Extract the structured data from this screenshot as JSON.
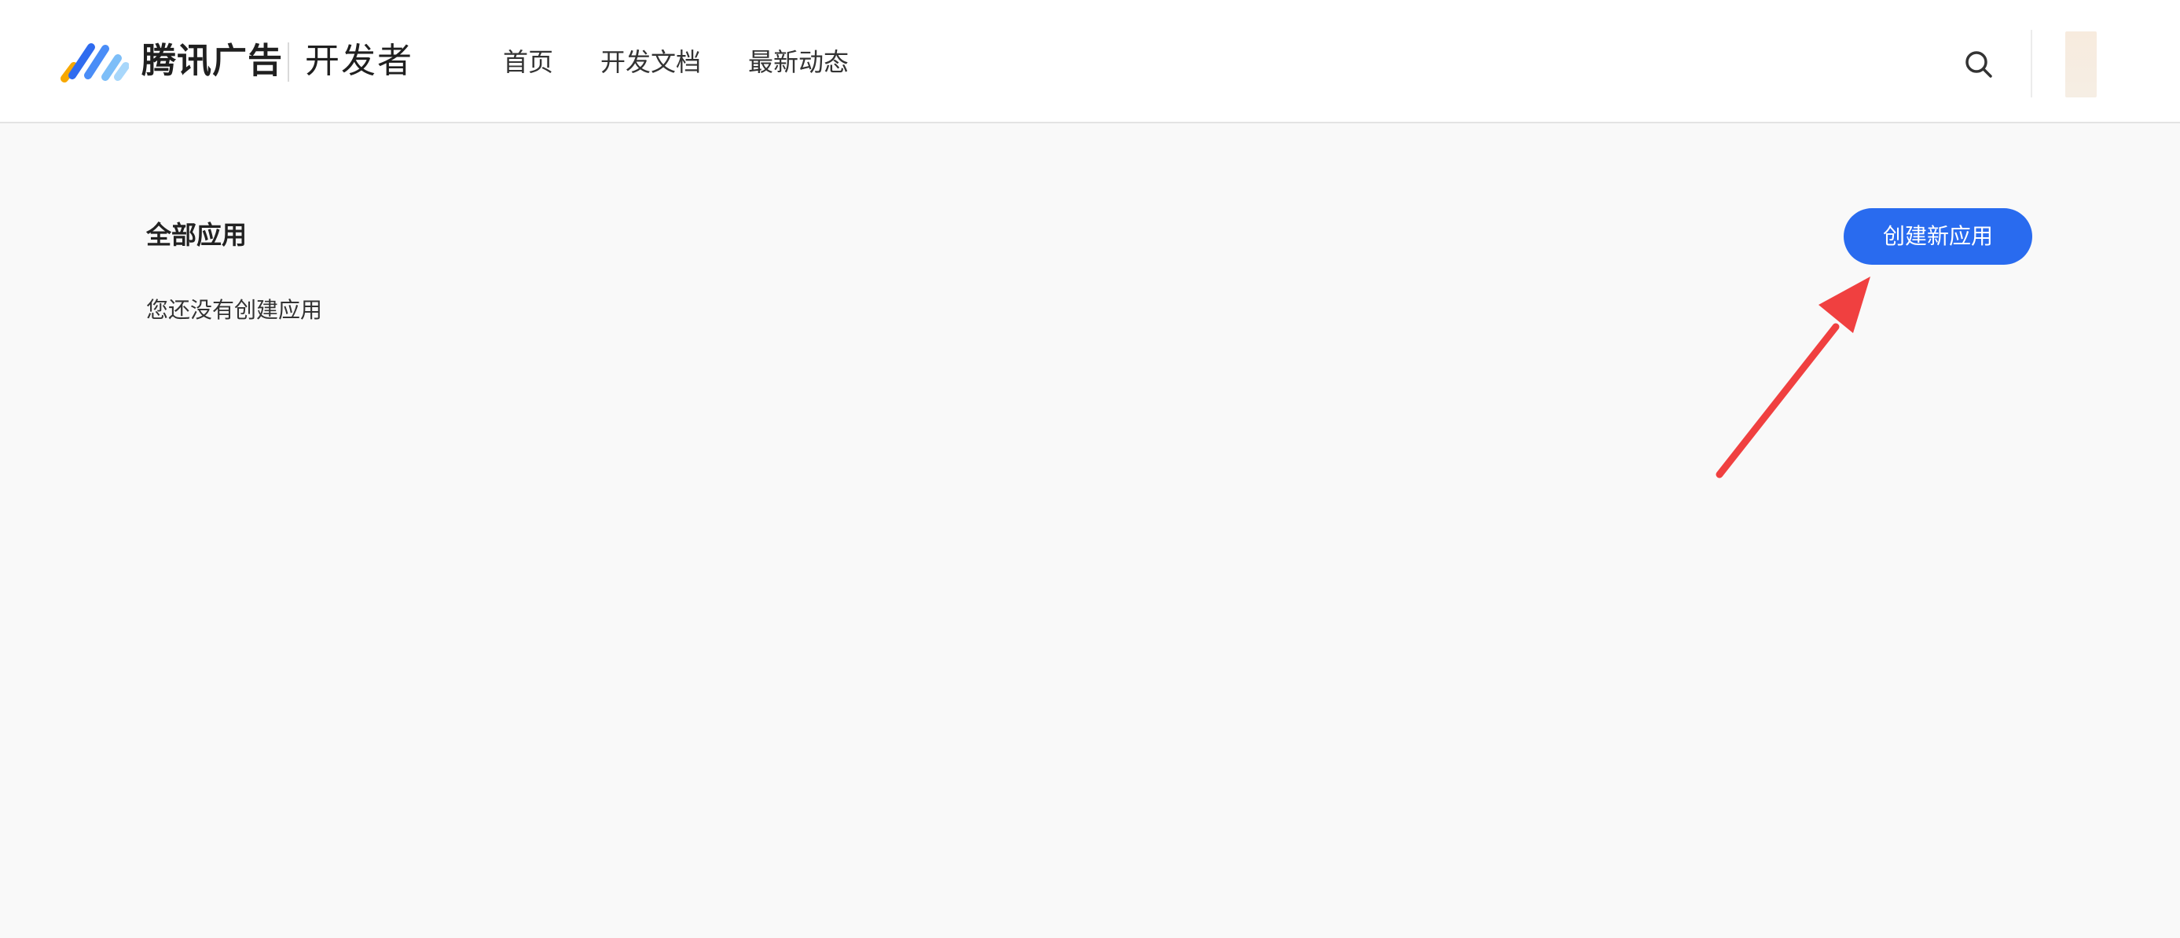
{
  "colors": {
    "primary": "#296bef",
    "background": "#f9f9f9",
    "header_bg": "#ffffff",
    "annotation_arrow": "#f04040"
  },
  "header": {
    "logo_icon": "tencent-ads-logo-icon",
    "brand": "腾讯广告",
    "brand_sub": "开发者",
    "nav": [
      {
        "label": "首页"
      },
      {
        "label": "开发文档"
      },
      {
        "label": "最新动态"
      }
    ],
    "search_icon": "search-icon",
    "avatar_icon": "user-avatar"
  },
  "main": {
    "section_title": "全部应用",
    "empty_text": "您还没有创建应用",
    "create_button": "创建新应用"
  },
  "annotation": {
    "icon": "red-arrow-icon",
    "points_to": "create-new-app-button"
  }
}
